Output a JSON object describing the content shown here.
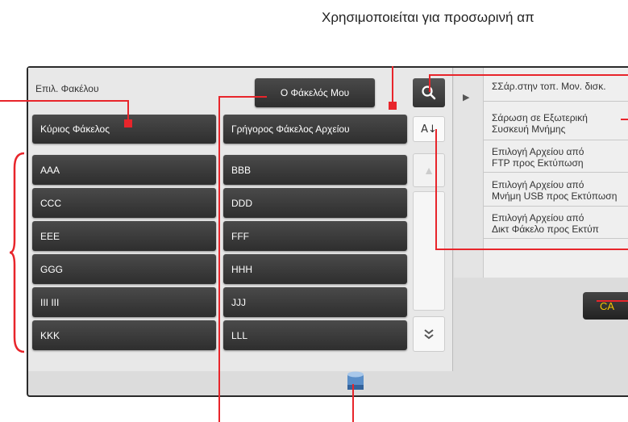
{
  "caption": "Χρησιμοποιείται για προσωρινή απ",
  "left_panel": {
    "title": "Επιλ. Φακέλου",
    "my_folder_button": "Ο Φάκελός Μου",
    "main_folder_tab": "Κύριος Φάκελος",
    "quick_folder_tab": "Γρήγορος Φάκελος Αρχείου",
    "sort_label": "A↓",
    "folders": [
      "AAA",
      "BBB",
      "CCC",
      "DDD",
      "EEE",
      "FFF",
      "GGG",
      "HHH",
      "III III",
      "JJJ",
      "KKK",
      "LLL"
    ]
  },
  "right_menu": {
    "items": [
      [
        "ΣΣάρ.στην τοπ. Μον. δισκ."
      ],
      [
        "Σάρωση σε Εξωτερική",
        "Συσκευή Μνήμης"
      ],
      [
        "Επιλογή Αρχείου από",
        "FTP προς Εκτύπωση"
      ],
      [
        "Επιλογή Αρχείου από",
        "Μνήμη USB προς Εκτύπωση"
      ],
      [
        "Επιλογή Αρχείου από",
        "Δικτ Φάκελο προς Εκτύπ"
      ]
    ]
  },
  "ca_button": "CA",
  "icons": {
    "search": "search-icon",
    "sort": "sort-icon",
    "scroll_up": "chevron-up-icon",
    "scroll_down": "chevron-double-down-icon",
    "expand": "play-icon",
    "storage": "storage-drive-icon"
  },
  "colors": {
    "callout": "#e8252b",
    "button_dark": "#333333",
    "ca_text": "#f5c400"
  }
}
